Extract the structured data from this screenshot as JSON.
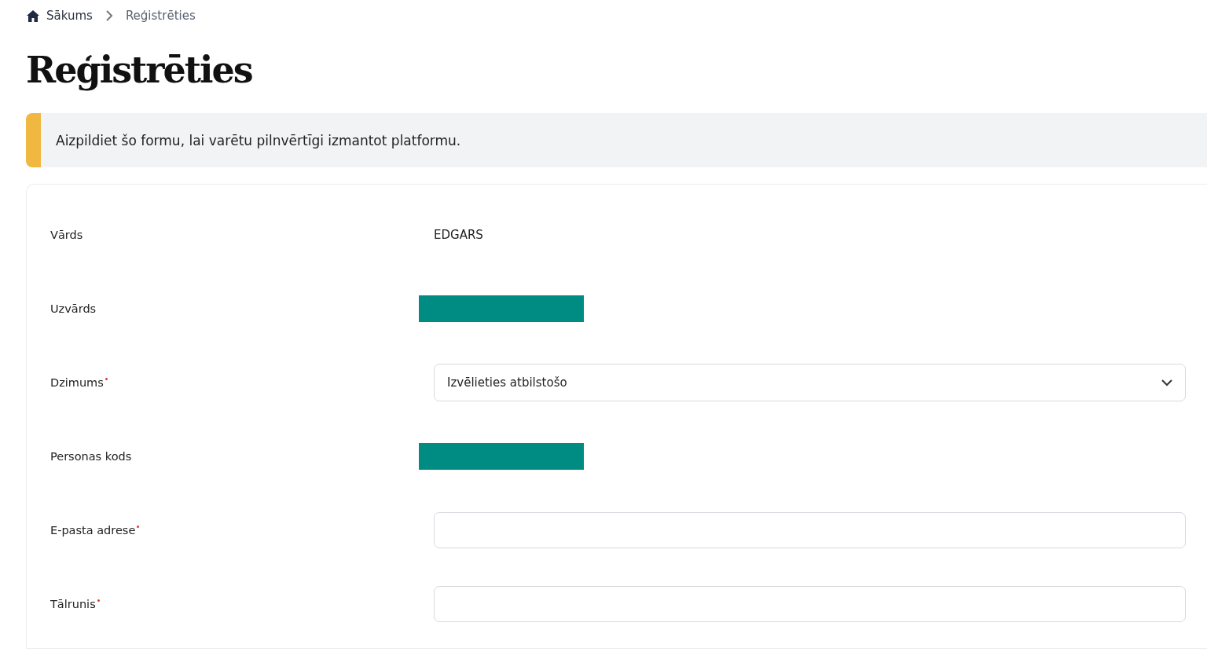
{
  "breadcrumb": [
    {
      "label": "Sākums",
      "home": true
    },
    {
      "label": "Reģistrēties",
      "home": false
    }
  ],
  "title": "Reģistrēties",
  "notice": {
    "text": "Aizpildiet šo formu, lai varētu pilnvērtīgi izmantot platformu."
  },
  "form": {
    "rows": [
      {
        "label": "Vārds",
        "required": false,
        "kind": "text",
        "value": "EDGARS"
      },
      {
        "label": "Uzvārds",
        "required": false,
        "kind": "redacted"
      },
      {
        "label": "Dzimums",
        "required": true,
        "kind": "select",
        "value": "Izvēlieties atbilstošo"
      },
      {
        "label": "Personas kods",
        "required": false,
        "kind": "redacted"
      },
      {
        "label": "E-pasta adrese",
        "required": true,
        "kind": "input"
      },
      {
        "label": "Tālrunis",
        "required": true,
        "kind": "input"
      }
    ]
  }
}
